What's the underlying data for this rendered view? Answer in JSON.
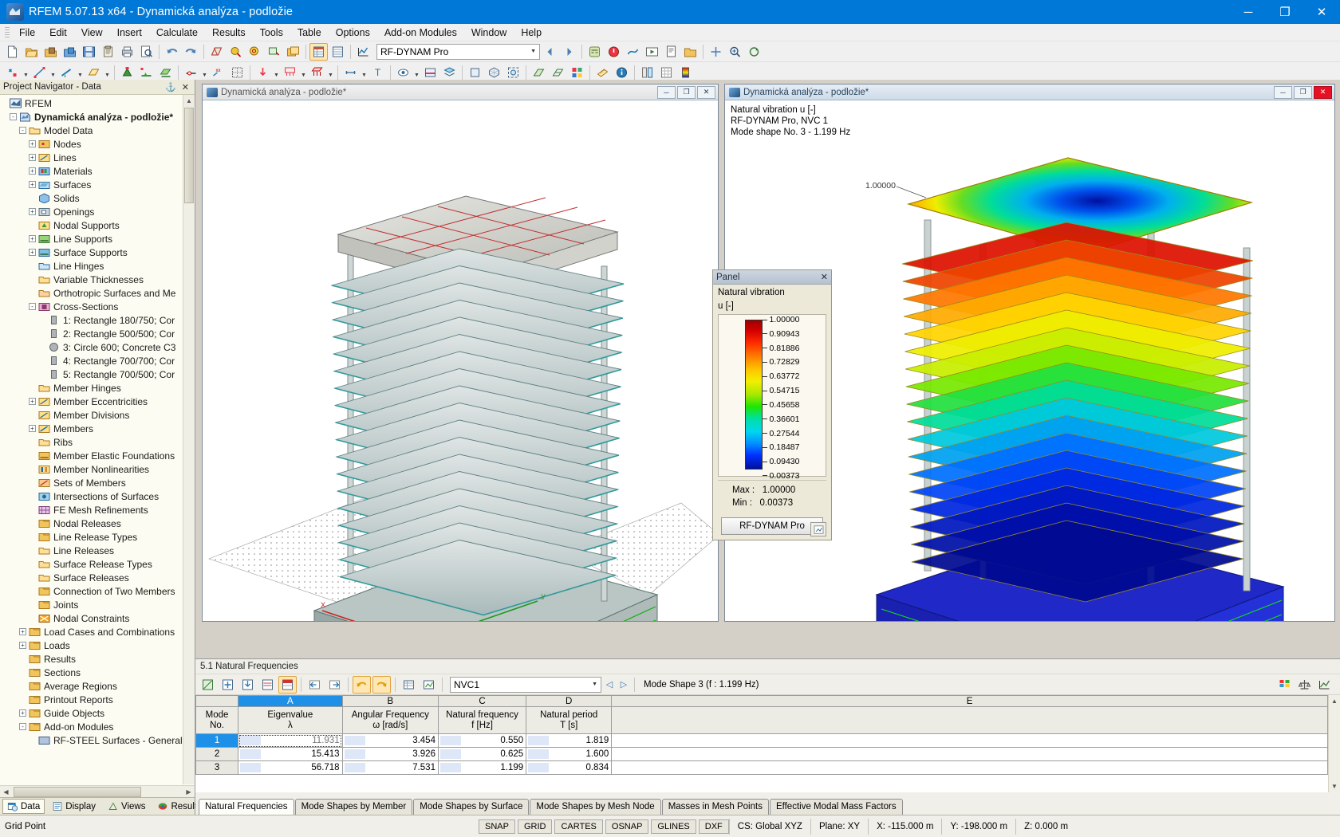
{
  "window": {
    "title": "RFEM 5.07.13 x64 - Dynamická analýza - podložie",
    "minimize": "─",
    "maximize": "❐",
    "close": "✕"
  },
  "menu": [
    "File",
    "Edit",
    "View",
    "Insert",
    "Calculate",
    "Results",
    "Tools",
    "Table",
    "Options",
    "Add-on Modules",
    "Window",
    "Help"
  ],
  "toolbar": {
    "module_combo": "RF-DYNAM Pro",
    "module_combo_caret": "▼"
  },
  "navigator": {
    "header": "Project Navigator - Data",
    "pin": "⚓",
    "close": "✕",
    "root": "RFEM",
    "project": "Dynamická analýza - podložie*",
    "items": [
      {
        "label": "Model Data",
        "indent": 1,
        "exp": "-",
        "icon": "folder-open"
      },
      {
        "label": "Nodes",
        "indent": 2,
        "exp": "+",
        "icon": "nodes"
      },
      {
        "label": "Lines",
        "indent": 2,
        "exp": "+",
        "icon": "lines"
      },
      {
        "label": "Materials",
        "indent": 2,
        "exp": "+",
        "icon": "materials"
      },
      {
        "label": "Surfaces",
        "indent": 2,
        "exp": "+",
        "icon": "surfaces"
      },
      {
        "label": "Solids",
        "indent": 2,
        "exp": "",
        "icon": "solids"
      },
      {
        "label": "Openings",
        "indent": 2,
        "exp": "+",
        "icon": "openings"
      },
      {
        "label": "Nodal Supports",
        "indent": 2,
        "exp": "",
        "icon": "nodal-supports"
      },
      {
        "label": "Line Supports",
        "indent": 2,
        "exp": "+",
        "icon": "line-supports"
      },
      {
        "label": "Surface Supports",
        "indent": 2,
        "exp": "+",
        "icon": "surface-supports"
      },
      {
        "label": "Line Hinges",
        "indent": 2,
        "exp": "",
        "icon": "line-hinges"
      },
      {
        "label": "Variable Thicknesses",
        "indent": 2,
        "exp": "",
        "icon": "variable-thicknesses"
      },
      {
        "label": "Orthotropic Surfaces and Me",
        "indent": 2,
        "exp": "",
        "icon": "orthotropic"
      },
      {
        "label": "Cross-Sections",
        "indent": 2,
        "exp": "-",
        "icon": "cross-sections"
      },
      {
        "label": "1: Rectangle 180/750; Cor",
        "indent": 3,
        "exp": "",
        "icon": "rect"
      },
      {
        "label": "2: Rectangle 500/500; Cor",
        "indent": 3,
        "exp": "",
        "icon": "rect"
      },
      {
        "label": "3: Circle 600; Concrete C3",
        "indent": 3,
        "exp": "",
        "icon": "circle"
      },
      {
        "label": "4: Rectangle 700/700; Cor",
        "indent": 3,
        "exp": "",
        "icon": "rect"
      },
      {
        "label": "5: Rectangle 700/500; Cor",
        "indent": 3,
        "exp": "",
        "icon": "rect"
      },
      {
        "label": "Member Hinges",
        "indent": 2,
        "exp": "",
        "icon": "member-hinges"
      },
      {
        "label": "Member Eccentricities",
        "indent": 2,
        "exp": "+",
        "icon": "member-ecc"
      },
      {
        "label": "Member Divisions",
        "indent": 2,
        "exp": "",
        "icon": "member-div"
      },
      {
        "label": "Members",
        "indent": 2,
        "exp": "+",
        "icon": "members"
      },
      {
        "label": "Ribs",
        "indent": 2,
        "exp": "",
        "icon": "ribs"
      },
      {
        "label": "Member Elastic Foundations",
        "indent": 2,
        "exp": "",
        "icon": "elastic-found"
      },
      {
        "label": "Member Nonlinearities",
        "indent": 2,
        "exp": "",
        "icon": "nonlinear"
      },
      {
        "label": "Sets of Members",
        "indent": 2,
        "exp": "",
        "icon": "sets"
      },
      {
        "label": "Intersections of Surfaces",
        "indent": 2,
        "exp": "",
        "icon": "intersections"
      },
      {
        "label": "FE Mesh Refinements",
        "indent": 2,
        "exp": "",
        "icon": "fe-mesh"
      },
      {
        "label": "Nodal Releases",
        "indent": 2,
        "exp": "",
        "icon": "folder"
      },
      {
        "label": "Line Release Types",
        "indent": 2,
        "exp": "",
        "icon": "folder"
      },
      {
        "label": "Line Releases",
        "indent": 2,
        "exp": "",
        "icon": "folder-open"
      },
      {
        "label": "Surface Release Types",
        "indent": 2,
        "exp": "",
        "icon": "folder-open"
      },
      {
        "label": "Surface Releases",
        "indent": 2,
        "exp": "",
        "icon": "folder-open"
      },
      {
        "label": "Connection of Two Members",
        "indent": 2,
        "exp": "",
        "icon": "folder"
      },
      {
        "label": "Joints",
        "indent": 2,
        "exp": "",
        "icon": "folder"
      },
      {
        "label": "Nodal Constraints",
        "indent": 2,
        "exp": "",
        "icon": "constraints"
      },
      {
        "label": "Load Cases and Combinations",
        "indent": 1,
        "exp": "+",
        "icon": "folder"
      },
      {
        "label": "Loads",
        "indent": 1,
        "exp": "+",
        "icon": "folder"
      },
      {
        "label": "Results",
        "indent": 1,
        "exp": "",
        "icon": "folder"
      },
      {
        "label": "Sections",
        "indent": 1,
        "exp": "",
        "icon": "folder"
      },
      {
        "label": "Average Regions",
        "indent": 1,
        "exp": "",
        "icon": "folder"
      },
      {
        "label": "Printout Reports",
        "indent": 1,
        "exp": "",
        "icon": "folder"
      },
      {
        "label": "Guide Objects",
        "indent": 1,
        "exp": "+",
        "icon": "folder"
      },
      {
        "label": "Add-on Modules",
        "indent": 1,
        "exp": "-",
        "icon": "folder"
      },
      {
        "label": "RF-STEEL Surfaces - General",
        "indent": 2,
        "exp": "",
        "icon": "module"
      }
    ],
    "tabs": [
      {
        "label": "Data",
        "icon": "data-icon",
        "active": true
      },
      {
        "label": "Display",
        "icon": "display-icon",
        "active": false
      },
      {
        "label": "Views",
        "icon": "views-icon",
        "active": false
      },
      {
        "label": "Results",
        "icon": "results-icon",
        "active": false
      }
    ]
  },
  "view_left": {
    "title": "Dynamická analýza - podložie*",
    "minimize": "─",
    "maximize": "❐",
    "close": "✕"
  },
  "view_right": {
    "title": "Dynamická analýza - podložie*",
    "minimize": "─",
    "maximize": "❐",
    "close": "✕",
    "note_line1": "Natural vibration u [-]",
    "note_line2": "RF-DYNAM Pro, NVC 1",
    "note_line3": "Mode shape No. 3 - 1.199 Hz",
    "max_label": "1.00000"
  },
  "panel": {
    "title": "Panel",
    "close": "✕",
    "subtitle1": "Natural vibration",
    "subtitle2": "u [-]",
    "legend_values": [
      "1.00000",
      "0.90943",
      "0.81886",
      "0.72829",
      "0.63772",
      "0.54715",
      "0.45658",
      "0.36601",
      "0.27544",
      "0.18487",
      "0.09430",
      "0.00373"
    ],
    "max_label": "Max  :",
    "max_value": "1.00000",
    "min_label": "Min   :",
    "min_value": "0.00373",
    "button": "RF-DYNAM Pro"
  },
  "table": {
    "caption": "5.1 Natural Frequencies",
    "load_case": "NVC1",
    "load_case_caret": "▼",
    "prev": "◁",
    "next": "▷",
    "mode_shape_status": "Mode Shape 3 (f : 1.199 Hz)",
    "column_letters": [
      "A",
      "B",
      "C",
      "D",
      "E"
    ],
    "row_header_line1": "Mode",
    "row_header_line2": "No.",
    "headers": [
      {
        "line1": "Eigenvalue",
        "line2": "λ"
      },
      {
        "line1": "Angular Frequency",
        "line2": "ω [rad/s]"
      },
      {
        "line1": "Natural frequency",
        "line2": "f [Hz]"
      },
      {
        "line1": "Natural period",
        "line2": "T [s]"
      }
    ],
    "rows": [
      {
        "no": "1",
        "eigenvalue": "11.931",
        "angular": "3.454",
        "frequency": "0.550",
        "period": "1.819"
      },
      {
        "no": "2",
        "eigenvalue": "15.413",
        "angular": "3.926",
        "frequency": "0.625",
        "period": "1.600"
      },
      {
        "no": "3",
        "eigenvalue": "56.718",
        "angular": "7.531",
        "frequency": "1.199",
        "period": "0.834"
      }
    ],
    "tabs": [
      {
        "label": "Natural Frequencies",
        "active": true
      },
      {
        "label": "Mode Shapes by Member",
        "active": false
      },
      {
        "label": "Mode Shapes by Surface",
        "active": false
      },
      {
        "label": "Mode Shapes by Mesh Node",
        "active": false
      },
      {
        "label": "Masses in Mesh Points",
        "active": false
      },
      {
        "label": "Effective Modal Mass Factors",
        "active": false
      }
    ]
  },
  "statusbar": {
    "grid_point": "Grid Point",
    "toggles": [
      "SNAP",
      "GRID",
      "CARTES",
      "OSNAP",
      "GLINES",
      "DXF"
    ],
    "cs": "CS: Global XYZ",
    "plane": "Plane: XY",
    "x": "X:  -115.000 m",
    "y": "Y:  -198.000 m",
    "z": "Z:  0.000 m"
  },
  "chart_data": {
    "type": "table",
    "title": "5.1 Natural Frequencies",
    "columns": [
      "Mode No.",
      "Eigenvalue λ",
      "Angular Frequency ω [rad/s]",
      "Natural frequency f [Hz]",
      "Natural period T [s]"
    ],
    "rows": [
      [
        1,
        11.931,
        3.454,
        0.55,
        1.819
      ],
      [
        2,
        15.413,
        3.926,
        0.625,
        1.6
      ],
      [
        3,
        56.718,
        7.531,
        1.199,
        0.834
      ]
    ],
    "legend": {
      "label": "Natural vibration u [-]",
      "values": [
        1.0,
        0.90943,
        0.81886,
        0.72829,
        0.63772,
        0.54715,
        0.45658,
        0.36601,
        0.27544,
        0.18487,
        0.0943,
        0.00373
      ],
      "max": 1.0,
      "min": 0.00373
    }
  }
}
